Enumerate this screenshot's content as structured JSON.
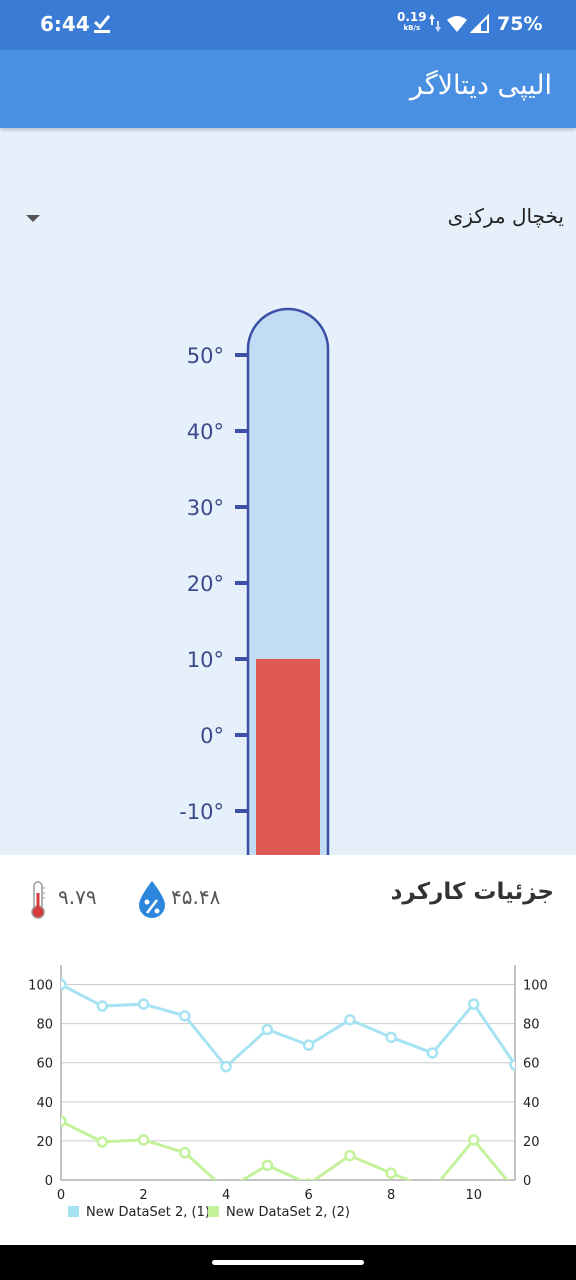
{
  "status_bar": {
    "time": "6:44",
    "net_speed": "0.19",
    "net_unit": "kB/s",
    "battery": "75%"
  },
  "app_bar": {
    "title": "الیپی دیتالاگر"
  },
  "device_selector": {
    "selected": "یخچال مرکزی"
  },
  "thermometer": {
    "ticks": [
      "50°",
      "40°",
      "30°",
      "20°",
      "10°",
      "0°",
      "-10°"
    ],
    "tick_values": [
      50,
      40,
      30,
      20,
      10,
      0,
      -10
    ],
    "mercury_top_value": 10,
    "colors": {
      "tube": "#c3dcf5",
      "outline": "#3c4ea6",
      "mercury": "#e05a55",
      "tick_label": "#3b4a8c"
    }
  },
  "details": {
    "title": "جزئیات کارکرد",
    "humidity": "۴۵.۴۸",
    "temperature": "۹.۷۹"
  },
  "chart_data": {
    "type": "line",
    "x": [
      0,
      1,
      2,
      3,
      4,
      5,
      6,
      7,
      8,
      9,
      10,
      11
    ],
    "x_ticks": [
      "0",
      "2",
      "4",
      "6",
      "8",
      "10"
    ],
    "y_ticks": [
      "0",
      "20",
      "40",
      "60",
      "80",
      "100"
    ],
    "ylim": [
      0,
      110
    ],
    "xlim": [
      0,
      11
    ],
    "grid": true,
    "legend": "bottom-left",
    "series": [
      {
        "name": "New DataSet 2, (1)",
        "color": "#a6e3f2",
        "values": [
          100,
          89,
          90,
          84,
          58,
          77,
          69,
          82,
          73,
          65,
          90,
          59
        ]
      },
      {
        "name": "New DataSet 2, (2)",
        "color": "#c4f29a",
        "values": [
          30,
          19.5,
          20.5,
          14,
          -5,
          7.5,
          -2,
          12.5,
          3.5,
          -5,
          20.5,
          -5
        ]
      }
    ]
  }
}
